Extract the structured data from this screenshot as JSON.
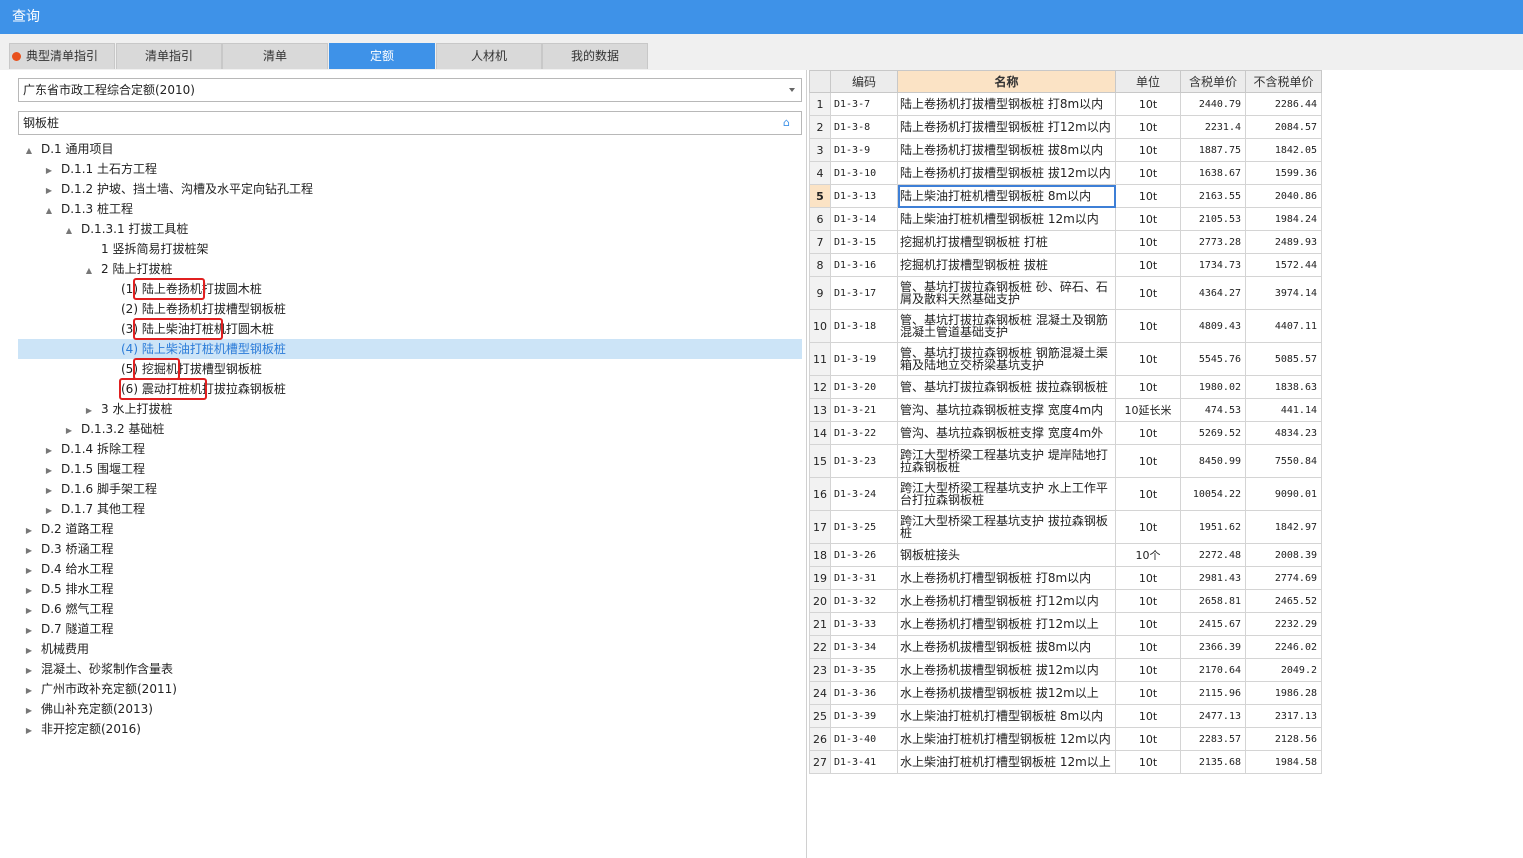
{
  "window": {
    "title": "查询"
  },
  "tabs": [
    "典型清单指引",
    "清单指引",
    "清单",
    "定额",
    "人材机",
    "我的数据"
  ],
  "active_tab": 3,
  "library_select": {
    "value": "广东省市政工程综合定额(2010)"
  },
  "search": {
    "value": "钢板桩"
  },
  "tree": [
    {
      "label": "D.1 通用项目",
      "toggle": "▲"
    },
    {
      "label": "D.1.1 土石方工程",
      "toggle": "▶"
    },
    {
      "label": "D.1.2 护坡、挡土墙、沟槽及水平定向钻孔工程",
      "toggle": "▶"
    },
    {
      "label": "D.1.3 桩工程",
      "toggle": "▲"
    },
    {
      "label": "D.1.3.1 打拔工具桩",
      "toggle": "▲"
    },
    {
      "label": "1 竖拆简易打拔桩架",
      "toggle": ""
    },
    {
      "label": "2 陆上打拔桩",
      "toggle": "▲"
    },
    {
      "label": "(1) 陆上卷扬机打拔圆木桩",
      "toggle": ""
    },
    {
      "label": "(2) 陆上卷扬机打拔槽型钢板桩",
      "toggle": ""
    },
    {
      "label": "(3) 陆上柴油打桩机打圆木桩",
      "toggle": ""
    },
    {
      "label": "(4) 陆上柴油打桩机槽型钢板桩",
      "toggle": ""
    },
    {
      "label": "(5) 挖掘机打拔槽型钢板桩",
      "toggle": ""
    },
    {
      "label": "(6) 震动打桩机打拔拉森钢板桩",
      "toggle": ""
    },
    {
      "label": "3 水上打拔桩",
      "toggle": "▶"
    },
    {
      "label": "D.1.3.2 基础桩",
      "toggle": "▶"
    },
    {
      "label": "D.1.4 拆除工程",
      "toggle": "▶"
    },
    {
      "label": "D.1.5 围堰工程",
      "toggle": "▶"
    },
    {
      "label": "D.1.6 脚手架工程",
      "toggle": "▶"
    },
    {
      "label": "D.1.7 其他工程",
      "toggle": "▶"
    },
    {
      "label": "D.2 道路工程",
      "toggle": "▶"
    },
    {
      "label": "D.3 桥涵工程",
      "toggle": "▶"
    },
    {
      "label": "D.4 给水工程",
      "toggle": "▶"
    },
    {
      "label": "D.5 排水工程",
      "toggle": "▶"
    },
    {
      "label": "D.6 燃气工程",
      "toggle": "▶"
    },
    {
      "label": "D.7 隧道工程",
      "toggle": "▶"
    },
    {
      "label": "机械费用",
      "toggle": "▶"
    },
    {
      "label": "混凝土、砂浆制作含量表",
      "toggle": "▶"
    },
    {
      "label": "广州市政补充定额(2011)",
      "toggle": "▶"
    },
    {
      "label": "佛山补充定额(2013)",
      "toggle": "▶"
    },
    {
      "label": "非开挖定额(2016)",
      "toggle": "▶"
    }
  ],
  "table": {
    "headers": [
      "",
      "编码",
      "名称",
      "单位",
      "含税单价",
      "不含税单价"
    ],
    "rows": [
      [
        "1",
        "D1-3-7",
        "陆上卷扬机打拔槽型钢板桩 打8m以内",
        "10t",
        "2440.79",
        "2286.44"
      ],
      [
        "2",
        "D1-3-8",
        "陆上卷扬机打拔槽型钢板桩 打12m以内",
        "10t",
        "2231.4",
        "2084.57"
      ],
      [
        "3",
        "D1-3-9",
        "陆上卷扬机打拔槽型钢板桩 拔8m以内",
        "10t",
        "1887.75",
        "1842.05"
      ],
      [
        "4",
        "D1-3-10",
        "陆上卷扬机打拔槽型钢板桩 拔12m以内",
        "10t",
        "1638.67",
        "1599.36"
      ],
      [
        "5",
        "D1-3-13",
        "陆上柴油打桩机槽型钢板桩 8m以内",
        "10t",
        "2163.55",
        "2040.86"
      ],
      [
        "6",
        "D1-3-14",
        "陆上柴油打桩机槽型钢板桩 12m以内",
        "10t",
        "2105.53",
        "1984.24"
      ],
      [
        "7",
        "D1-3-15",
        "挖掘机打拔槽型钢板桩 打桩",
        "10t",
        "2773.28",
        "2489.93"
      ],
      [
        "8",
        "D1-3-16",
        "挖掘机打拔槽型钢板桩 拔桩",
        "10t",
        "1734.73",
        "1572.44"
      ],
      [
        "9",
        "D1-3-17",
        "管、基坑打拔拉森钢板桩 砂、碎石、石屑及散料天然基础支护",
        "10t",
        "4364.27",
        "3974.14"
      ],
      [
        "10",
        "D1-3-18",
        "管、基坑打拔拉森钢板桩 混凝土及钢筋混凝土管道基础支护",
        "10t",
        "4809.43",
        "4407.11"
      ],
      [
        "11",
        "D1-3-19",
        "管、基坑打拔拉森钢板桩 钢筋混凝土渠箱及陆地立交桥梁基坑支护",
        "10t",
        "5545.76",
        "5085.57"
      ],
      [
        "12",
        "D1-3-20",
        "管、基坑打拔拉森钢板桩 拔拉森钢板桩",
        "10t",
        "1980.02",
        "1838.63"
      ],
      [
        "13",
        "D1-3-21",
        "管沟、基坑拉森钢板桩支撑 宽度4m内",
        "10延长米",
        "474.53",
        "441.14"
      ],
      [
        "14",
        "D1-3-22",
        "管沟、基坑拉森钢板桩支撑 宽度4m外",
        "10t",
        "5269.52",
        "4834.23"
      ],
      [
        "15",
        "D1-3-23",
        "跨江大型桥梁工程基坑支护 堤岸陆地打拉森钢板桩",
        "10t",
        "8450.99",
        "7550.84"
      ],
      [
        "16",
        "D1-3-24",
        "跨江大型桥梁工程基坑支护 水上工作平台打拉森钢板桩",
        "10t",
        "10054.22",
        "9090.01"
      ],
      [
        "17",
        "D1-3-25",
        "跨江大型桥梁工程基坑支护 拔拉森钢板桩",
        "10t",
        "1951.62",
        "1842.97"
      ],
      [
        "18",
        "D1-3-26",
        "钢板桩接头",
        "10个",
        "2272.48",
        "2008.39"
      ],
      [
        "19",
        "D1-3-31",
        "水上卷扬机打槽型钢板桩 打8m以内",
        "10t",
        "2981.43",
        "2774.69"
      ],
      [
        "20",
        "D1-3-32",
        "水上卷扬机打槽型钢板桩 打12m以内",
        "10t",
        "2658.81",
        "2465.52"
      ],
      [
        "21",
        "D1-3-33",
        "水上卷扬机打槽型钢板桩 打12m以上",
        "10t",
        "2415.67",
        "2232.29"
      ],
      [
        "22",
        "D1-3-34",
        "水上卷扬机拔槽型钢板桩 拔8m以内",
        "10t",
        "2366.39",
        "2246.02"
      ],
      [
        "23",
        "D1-3-35",
        "水上卷扬机拔槽型钢板桩 拔12m以内",
        "10t",
        "2170.64",
        "2049.2"
      ],
      [
        "24",
        "D1-3-36",
        "水上卷扬机拔槽型钢板桩 拔12m以上",
        "10t",
        "2115.96",
        "1986.28"
      ],
      [
        "25",
        "D1-3-39",
        "水上柴油打桩机打槽型钢板桩 8m以内",
        "10t",
        "2477.13",
        "2317.13"
      ],
      [
        "26",
        "D1-3-40",
        "水上柴油打桩机打槽型钢板桩 12m以内",
        "10t",
        "2283.57",
        "2128.56"
      ],
      [
        "27",
        "D1-3-41",
        "水上柴油打桩机打槽型钢板桩 12m以上",
        "10t",
        "2135.68",
        "1984.58"
      ]
    ],
    "current_row": 4
  },
  "colors": {
    "accent": "#3e92e8",
    "highlight_box": "#e02020",
    "selected_row": "#cce4f7",
    "name_header": "#fbe3c5"
  }
}
